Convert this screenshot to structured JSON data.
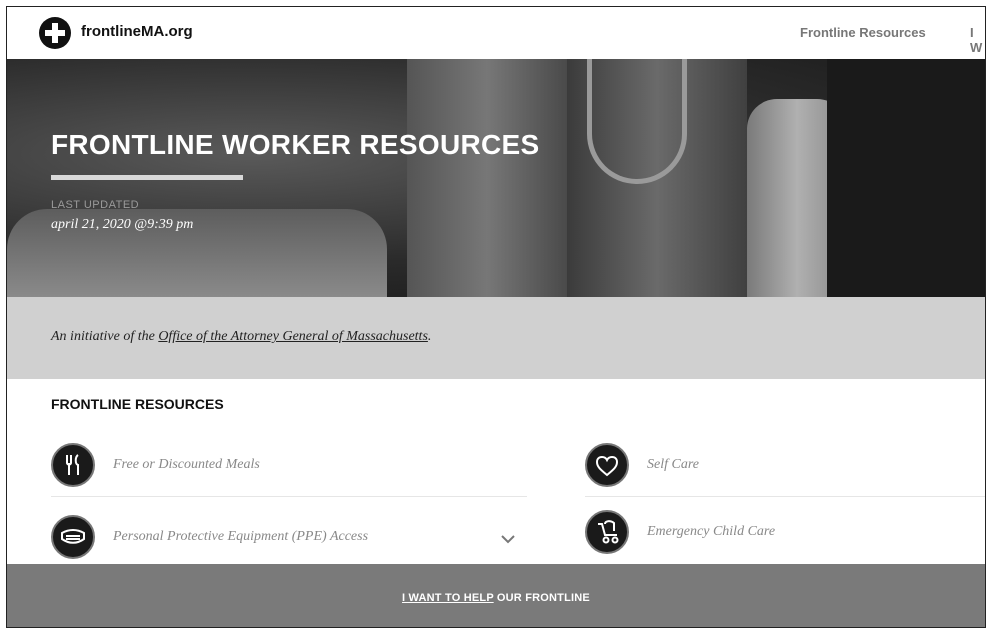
{
  "header": {
    "site_name": "frontlineMA.org",
    "nav": [
      "Frontline Resources",
      "I W"
    ]
  },
  "hero": {
    "title": "FRONTLINE WORKER RESOURCES",
    "last_updated_label": "LAST UPDATED",
    "updated_date": "april 21, 2020 @9:39 pm"
  },
  "initiative": {
    "prefix": "An initiative of the ",
    "link": "Office of the Attorney General of Massachusetts",
    "suffix": "."
  },
  "resources": {
    "title": "FRONTLINE RESOURCES",
    "items": [
      {
        "label": "Free or Discounted Meals",
        "icon": "utensils-icon"
      },
      {
        "label": "Personal Protective Equipment (PPE) Access",
        "icon": "mask-icon"
      },
      {
        "label": "Self Care",
        "icon": "heart-icon"
      },
      {
        "label": "Emergency Child Care",
        "icon": "stroller-icon"
      }
    ]
  },
  "footer": {
    "help_link": "I WANT TO HELP",
    "help_rest": " OUR FRONTLINE"
  }
}
